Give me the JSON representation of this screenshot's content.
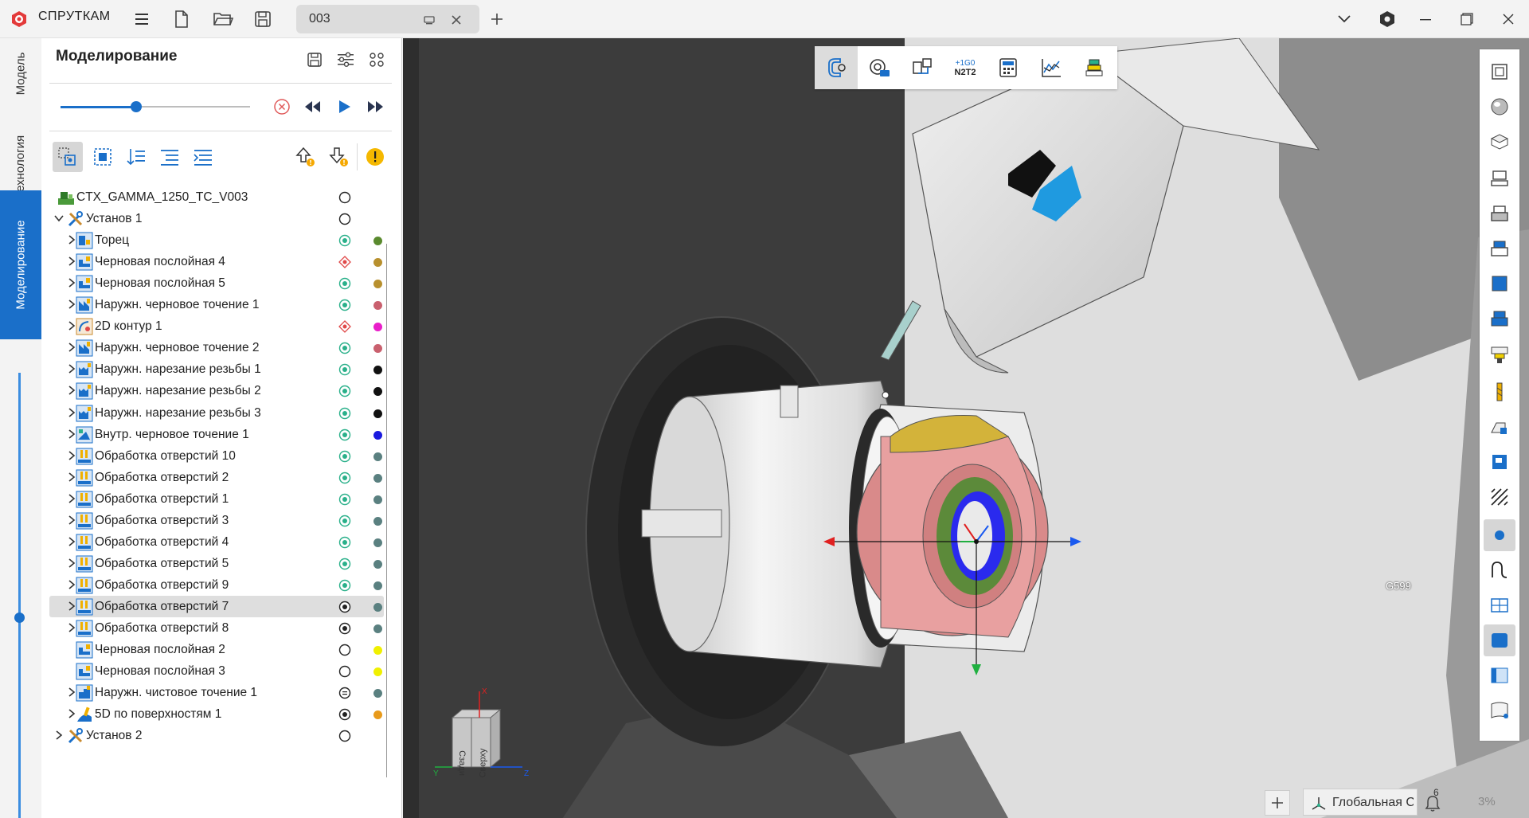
{
  "app": {
    "name": "СПРУТКАМ"
  },
  "document_tab": {
    "name": "003"
  },
  "vertical_tabs": [
    "Модель",
    "Технология",
    "Моделирование"
  ],
  "panel": {
    "title": "Моделирование",
    "timeline_progress": 0.4
  },
  "tree": [
    {
      "label": "CTX_GAMMA_1250_TC_V003",
      "level": 0,
      "expander": "none",
      "icon": "machine-icon",
      "status": "empty",
      "color": null
    },
    {
      "label": "Установ 1",
      "level": 0,
      "expander": "expanded",
      "icon": "setup-tools-icon",
      "status": "empty",
      "color": null
    },
    {
      "label": "Торец",
      "level": 1,
      "expander": "collapsed",
      "icon": "facing-op-icon",
      "status": "done",
      "color": "#5a8a2e"
    },
    {
      "label": "Черновая послойная 4",
      "level": 1,
      "expander": "collapsed",
      "icon": "roughing-op-icon",
      "status": "warning",
      "color": "#b8902e"
    },
    {
      "label": "Черновая послойная 5",
      "level": 1,
      "expander": "collapsed",
      "icon": "roughing-op-icon",
      "status": "done",
      "color": "#b8902e"
    },
    {
      "label": "Наружн. черновое точение 1",
      "level": 1,
      "expander": "collapsed",
      "icon": "turning-op-icon",
      "status": "done",
      "color": "#c9606e"
    },
    {
      "label": "2D контур 1",
      "level": 1,
      "expander": "collapsed",
      "icon": "contour-op-icon",
      "status": "warning",
      "color": "#e91ec9"
    },
    {
      "label": "Наружн. черновое точение 2",
      "level": 1,
      "expander": "collapsed",
      "icon": "turning-op-icon",
      "status": "done",
      "color": "#c9606e"
    },
    {
      "label": "Наружн. нарезание резьбы 1",
      "level": 1,
      "expander": "collapsed",
      "icon": "threading-op-icon",
      "status": "done",
      "color": "#111111"
    },
    {
      "label": "Наружн. нарезание резьбы 2",
      "level": 1,
      "expander": "collapsed",
      "icon": "threading-op-icon",
      "status": "done",
      "color": "#111111"
    },
    {
      "label": "Наружн. нарезание резьбы 3",
      "level": 1,
      "expander": "collapsed",
      "icon": "threading-op-icon",
      "status": "done",
      "color": "#111111"
    },
    {
      "label": "Внутр. черновое точение 1",
      "level": 1,
      "expander": "collapsed",
      "icon": "inner-turning-op-icon",
      "status": "done",
      "color": "#1a1adf"
    },
    {
      "label": "Обработка отверстий 10",
      "level": 1,
      "expander": "collapsed",
      "icon": "drilling-op-icon",
      "status": "done",
      "color": "#5a8080"
    },
    {
      "label": "Обработка отверстий 2",
      "level": 1,
      "expander": "collapsed",
      "icon": "drilling-op-icon",
      "status": "done",
      "color": "#5a8080"
    },
    {
      "label": "Обработка отверстий 1",
      "level": 1,
      "expander": "collapsed",
      "icon": "drilling-op-icon",
      "status": "done",
      "color": "#5a8080"
    },
    {
      "label": "Обработка отверстий 3",
      "level": 1,
      "expander": "collapsed",
      "icon": "drilling-op-icon",
      "status": "done",
      "color": "#5a8080"
    },
    {
      "label": "Обработка отверстий 4",
      "level": 1,
      "expander": "collapsed",
      "icon": "drilling-op-icon",
      "status": "done",
      "color": "#5a8080"
    },
    {
      "label": "Обработка отверстий 5",
      "level": 1,
      "expander": "collapsed",
      "icon": "drilling-op-icon",
      "status": "done",
      "color": "#5a8080"
    },
    {
      "label": "Обработка отверстий 9",
      "level": 1,
      "expander": "collapsed",
      "icon": "drilling-op-icon",
      "status": "done",
      "color": "#5a8080"
    },
    {
      "label": "Обработка отверстий 7",
      "level": 1,
      "expander": "collapsed",
      "icon": "drilling-op-icon",
      "status": "current",
      "color": "#5a8080",
      "selected": true
    },
    {
      "label": "Обработка отверстий 8",
      "level": 1,
      "expander": "collapsed",
      "icon": "drilling-op-icon",
      "status": "current",
      "color": "#5a8080"
    },
    {
      "label": "Черновая послойная 2",
      "level": 1,
      "expander": "none",
      "icon": "roughing-op-icon",
      "status": "empty",
      "color": "#f0f000"
    },
    {
      "label": "Черновая послойная 3",
      "level": 1,
      "expander": "none",
      "icon": "roughing-op-icon",
      "status": "empty",
      "color": "#f0f000"
    },
    {
      "label": "Наружн. чистовое точение 1",
      "level": 1,
      "expander": "collapsed",
      "icon": "finishing-op-icon",
      "status": "paused",
      "color": "#5a8080"
    },
    {
      "label": "5D по поверхностям 1",
      "level": 1,
      "expander": "collapsed",
      "icon": "5d-surface-op-icon",
      "status": "current",
      "color": "#e89a1a"
    },
    {
      "label": "Установ 2",
      "level": 0,
      "expander": "collapsed",
      "icon": "setup-tools-icon",
      "status": "empty",
      "color": null
    }
  ],
  "viewport": {
    "toolbar_buttons": [
      "snap-icon",
      "camera-view-icon",
      "machine-view-icon",
      "gcode-numbers-icon",
      "calculator-icon",
      "graph-icon",
      "layers-icon"
    ],
    "gcode_icon_text": [
      "+1G0",
      "N2T2"
    ],
    "coord_label": "G599",
    "view_cube_faces": [
      "Сзади",
      "Сверху"
    ],
    "axes": [
      "X",
      "Y",
      "Z"
    ],
    "coord_system": "Глобальная СК",
    "notifications_count": "6",
    "zoom": "3%"
  },
  "colors": {
    "accent": "#1a6fc9",
    "status_green": "#2ab08a",
    "status_red": "#e04848"
  }
}
